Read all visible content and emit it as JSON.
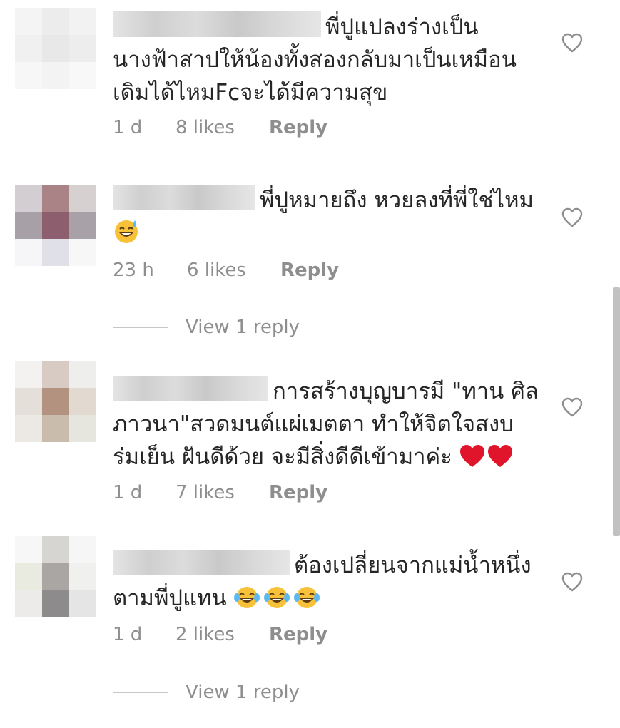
{
  "comments": [
    {
      "text": "พี่ปูแปลงร่างเป็นนางฟ้าสาปให้น้องทั้งสองกลับมาเป็นเหมือนเดิมได้ไหมFcจะได้มีความสุข",
      "age": "1 d",
      "likes": "8 likes",
      "reply": "Reply"
    },
    {
      "text": "พี่ปูหมายถึง หวยลงที่พี่ใช่ไหม",
      "emoji": "sweat-smile-emoji",
      "age": "23 h",
      "likes": "6 likes",
      "reply": "Reply",
      "view_replies": "View 1 reply"
    },
    {
      "text": "การสร้างบุญบารมี \"ทาน ศิล ภาวนา\"สวดมนต์แผ่เมตตา ทำให้จิตใจสงบร่มเย็น ฝันดีด้วย จะมีสิ่งดีดีเข้ามาค่ะ",
      "emoji": "red-heart-emoji x2",
      "age": "1 d",
      "likes": "7 likes",
      "reply": "Reply"
    },
    {
      "text": "ต้องเปลี่ยนจากแม่น้ำหนึ่งตามพี่ปูแทน",
      "emoji": "tears-of-joy-emoji x3",
      "age": "1 d",
      "likes": "2 likes",
      "reply": "Reply",
      "view_replies": "View 1 reply"
    }
  ],
  "icons": {
    "like": "heart-outline-icon"
  },
  "colors": {
    "text": "#262626",
    "meta": "#8e8e8e",
    "divider": "#c7c7c7"
  }
}
